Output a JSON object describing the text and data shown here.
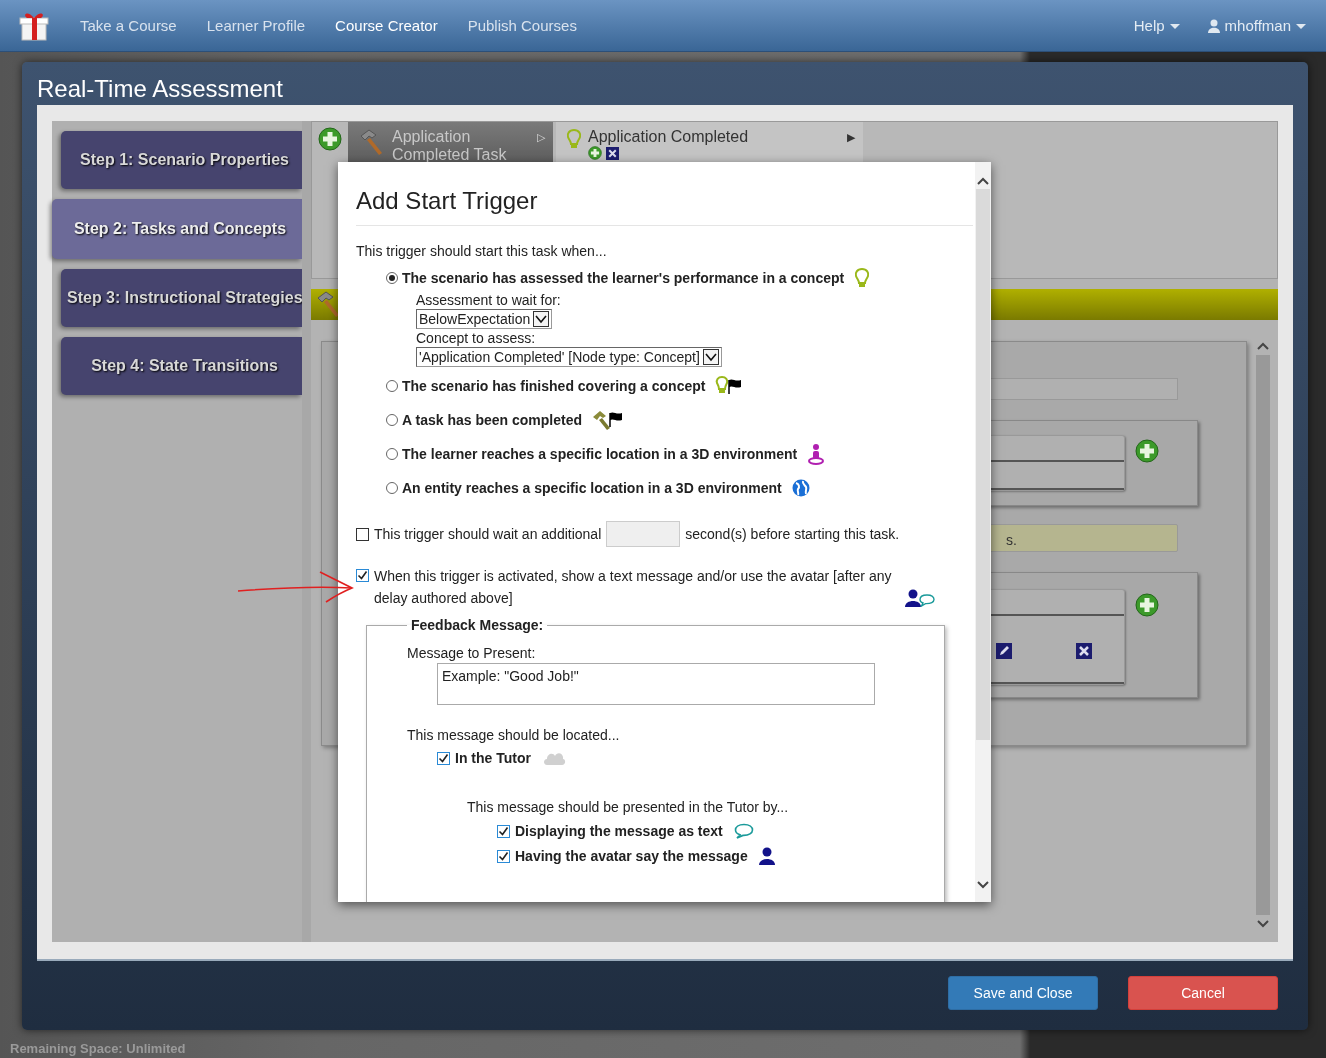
{
  "navbar": {
    "links": [
      {
        "label": "Take a Course",
        "selected": false
      },
      {
        "label": "Learner Profile",
        "selected": false
      },
      {
        "label": "Course Creator",
        "selected": true
      },
      {
        "label": "Publish Courses",
        "selected": false
      }
    ],
    "help": "Help",
    "user": "mhoffman"
  },
  "status_text": "Remaining Space: Unlimited",
  "modal": {
    "title": "Real-Time Assessment",
    "steps": [
      {
        "label": "Step 1: Scenario Properties",
        "selected": false
      },
      {
        "label": "Step 2: Tasks and Concepts",
        "selected": true
      },
      {
        "label": "Step 3: Instructional Strategies",
        "selected": false
      },
      {
        "label": "Step 4: State Transitions",
        "selected": false
      }
    ],
    "tabs": [
      {
        "label": "Application Completed Task",
        "arrow": "▷",
        "kind": "task",
        "selected": true
      },
      {
        "label": "Application Completed",
        "arrow": "▶",
        "kind": "concept",
        "selected": false
      }
    ],
    "note": "s.",
    "buttons": [
      {
        "label": "Save and Close",
        "kind": "primary"
      },
      {
        "label": "Cancel",
        "kind": "danger"
      }
    ]
  },
  "dialog": {
    "title": "Add Start Trigger",
    "intro": "This trigger should start this task when...",
    "options": [
      {
        "label": "The scenario has assessed the learner's performance in a concept",
        "kind": "concept-assessed",
        "selected": true
      },
      {
        "label": "The scenario has finished covering a concept",
        "kind": "concept-covered",
        "selected": false
      },
      {
        "label": "A task has been completed",
        "kind": "task-completed",
        "selected": false
      },
      {
        "label": "The learner reaches a specific location in a 3D environment",
        "kind": "learner-location",
        "selected": false
      },
      {
        "label": "An entity reaches a specific location in a 3D environment",
        "kind": "entity-location",
        "selected": false
      }
    ],
    "assessment": {
      "label": "Assessment to wait for:",
      "value": "BelowExpectation"
    },
    "concept": {
      "label": "Concept to assess:",
      "value": "'Application Completed' [Node type: Concept]"
    },
    "delay": {
      "checked": false,
      "before": "This trigger should wait an additional",
      "after": "second(s) before starting this task."
    },
    "message": {
      "checked": true,
      "text": "When this trigger is activated, show a text message and/or use the avatar [after any delay authored above]"
    },
    "feedback": {
      "legend": "Feedback Message:",
      "message_label": "Message to Present:",
      "placeholder": "Example: \"Good Job!\"",
      "location_label": "This message should be located...",
      "location": {
        "label": "In the Tutor",
        "checked": true
      },
      "presented_label": "This message should be presented in the Tutor by...",
      "methods": [
        {
          "label": "Displaying the message as text",
          "kind": "text",
          "checked": true
        },
        {
          "label": "Having the avatar say the message",
          "kind": "avatar",
          "checked": true
        }
      ]
    }
  }
}
